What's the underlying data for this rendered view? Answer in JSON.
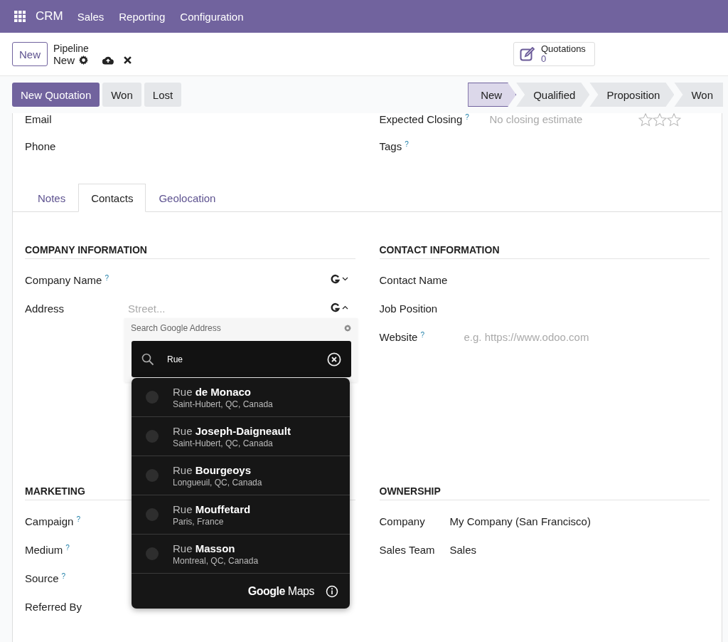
{
  "navbar": {
    "app": "CRM",
    "menus": [
      "Sales",
      "Reporting",
      "Configuration"
    ]
  },
  "control_panel": {
    "new_button": "New",
    "breadcrumb": "Pipeline",
    "record": "New",
    "smart_button": {
      "label": "Quotations",
      "count": "0"
    }
  },
  "actions": [
    {
      "label": "New Quotation",
      "kind": "primary"
    },
    {
      "label": "Won",
      "kind": "secondary"
    },
    {
      "label": "Lost",
      "kind": "secondary"
    }
  ],
  "stages": [
    {
      "label": "New",
      "selected": true
    },
    {
      "label": "Qualified",
      "selected": false
    },
    {
      "label": "Proposition",
      "selected": false
    },
    {
      "label": "Won",
      "selected": false
    }
  ],
  "header_fields": {
    "left": [
      {
        "label": "Email"
      },
      {
        "label": "Phone"
      }
    ],
    "right": [
      {
        "label": "Expected Closing",
        "help": "?",
        "placeholder": "No closing estimate",
        "stars": 0
      },
      {
        "label": "Tags",
        "help": "?"
      }
    ]
  },
  "tabs": [
    {
      "label": "Notes",
      "selected": false
    },
    {
      "label": "Contacts",
      "selected": true
    },
    {
      "label": "Geolocation",
      "selected": false
    }
  ],
  "sections": [
    {
      "title": "COMPANY INFORMATION",
      "fields": [
        {
          "label": "Company Name",
          "help": "?",
          "kind": "google",
          "expanded": false
        },
        {
          "label": "Address",
          "kind": "address",
          "placeholder": "Street...",
          "expanded": true
        }
      ]
    },
    {
      "title": "CONTACT INFORMATION",
      "fields": [
        {
          "label": "Contact Name",
          "kind": "plain"
        },
        {
          "label": "Job Position",
          "kind": "plain"
        },
        {
          "label": "Website",
          "help": "?",
          "kind": "plain",
          "placeholder": "e.g. https://www.odoo.com"
        }
      ]
    },
    {
      "title": "MARKETING",
      "fields": [
        {
          "label": "Campaign",
          "help": "?",
          "kind": "plain"
        },
        {
          "label": "Medium",
          "help": "?",
          "kind": "plain"
        },
        {
          "label": "Source",
          "help": "?",
          "kind": "plain"
        },
        {
          "label": "Referred By",
          "kind": "plain"
        }
      ]
    },
    {
      "title": "OWNERSHIP",
      "fields": [
        {
          "label": "Company",
          "kind": "plain",
          "value": "My Company (San Francisco)"
        },
        {
          "label": "Sales Team",
          "kind": "plain",
          "value": "Sales"
        }
      ]
    }
  ],
  "address_search": {
    "title": "Search Google Address",
    "query": "Rue",
    "footer": "**Google** Maps",
    "suggestions": [
      {
        "main": "Rue **de Monaco**",
        "secondary": "Saint-Hubert, QC, Canada"
      },
      {
        "main": "Rue **Joseph-Daigneault**",
        "secondary": "Saint-Hubert, QC, Canada"
      },
      {
        "main": "Rue **Bourgeoys**",
        "secondary": "Longueuil, QC, Canada"
      },
      {
        "main": "Rue **Mouffetard**",
        "secondary": "Paris, France"
      },
      {
        "main": "Rue **Masson**",
        "secondary": "Montreal, QC, Canada"
      }
    ]
  }
}
